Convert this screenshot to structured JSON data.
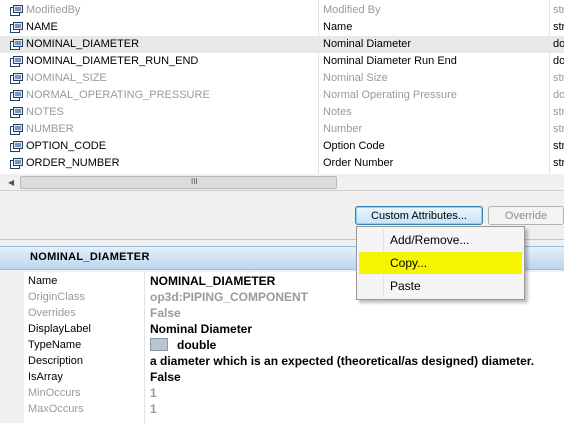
{
  "grid": {
    "rows": [
      {
        "name": "ModifiedBy",
        "display": "Modified By",
        "type": "str",
        "dim": true,
        "selected": false
      },
      {
        "name": "NAME",
        "display": "Name",
        "type": "str",
        "dim": false,
        "selected": false
      },
      {
        "name": "NOMINAL_DIAMETER",
        "display": "Nominal Diameter",
        "type": "do",
        "dim": false,
        "selected": true
      },
      {
        "name": "NOMINAL_DIAMETER_RUN_END",
        "display": "Nominal Diameter Run End",
        "type": "do",
        "dim": false,
        "selected": false
      },
      {
        "name": "NOMINAL_SIZE",
        "display": "Nominal Size",
        "type": "str",
        "dim": true,
        "selected": false
      },
      {
        "name": "NORMAL_OPERATING_PRESSURE",
        "display": "Normal Operating Pressure",
        "type": "do",
        "dim": true,
        "selected": false
      },
      {
        "name": "NOTES",
        "display": "Notes",
        "type": "str",
        "dim": true,
        "selected": false
      },
      {
        "name": "NUMBER",
        "display": "Number",
        "type": "str",
        "dim": true,
        "selected": false
      },
      {
        "name": "OPTION_CODE",
        "display": "Option Code",
        "type": "str",
        "dim": false,
        "selected": false
      },
      {
        "name": "ORDER_NUMBER",
        "display": "Order Number",
        "type": "str",
        "dim": false,
        "selected": false
      }
    ],
    "scroll_grip": "III"
  },
  "buttons": {
    "custom_attributes": "Custom Attributes...",
    "override": "Override"
  },
  "context_menu": {
    "items": [
      {
        "label": "Add/Remove...",
        "highlighted": false
      },
      {
        "label": "Copy...",
        "highlighted": true
      },
      {
        "label": "Paste",
        "highlighted": false
      }
    ]
  },
  "details": {
    "title": "NOMINAL_DIAMETER",
    "properties": [
      {
        "name": "Name",
        "value": "NOMINAL_DIAMETER",
        "dim": false,
        "value_dim": false
      },
      {
        "name": "OriginClass",
        "value": "op3d:PIPING_COMPONENT",
        "dim": true,
        "value_dim": true
      },
      {
        "name": "Overrides",
        "value": "False",
        "dim": true,
        "value_dim": true
      },
      {
        "name": "DisplayLabel",
        "value": "Nominal Diameter",
        "dim": false,
        "value_dim": false
      },
      {
        "name": "TypeName",
        "value": "double",
        "dim": false,
        "value_dim": false,
        "has_icon": true
      },
      {
        "name": "Description",
        "value": "a diameter which is an expected (theoretical/as designed) diameter.",
        "dim": false,
        "value_dim": false
      },
      {
        "name": "IsArray",
        "value": "False",
        "dim": false,
        "value_dim": false
      },
      {
        "name": "MinOccurs",
        "value": "1",
        "dim": true,
        "value_dim": true
      },
      {
        "name": "MaxOccurs",
        "value": "1",
        "dim": true,
        "value_dim": true
      }
    ]
  },
  "colors": {
    "menu_highlight": "#f5f500",
    "panel_header": "#bcd6ee",
    "dim_text": "#9a9a9a"
  }
}
